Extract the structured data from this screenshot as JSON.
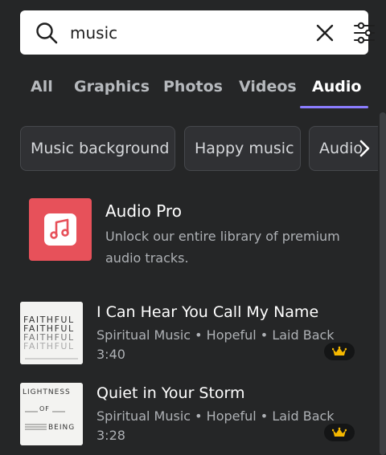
{
  "search": {
    "value": "music",
    "icon": "search-icon",
    "clear_icon": "close-icon",
    "filter_icon": "filter-sliders-icon"
  },
  "tabs": [
    {
      "label": "All"
    },
    {
      "label": "Graphics"
    },
    {
      "label": "Photos"
    },
    {
      "label": "Videos"
    },
    {
      "label": "Audio",
      "active": true
    }
  ],
  "chips": [
    {
      "label": "Music background"
    },
    {
      "label": "Happy music"
    },
    {
      "label": "Audio"
    }
  ],
  "promo": {
    "title": "Audio Pro",
    "description": "Unlock our entire library of premium audio tracks.",
    "icon": "music-note-icon"
  },
  "tracks": [
    {
      "title": "I Can Hear You Call My Name",
      "meta": "Spiritual Music • Hopeful • Laid Back",
      "duration": "3:40",
      "cover_text": "FAITHFUL",
      "badge_icon": "crown-icon"
    },
    {
      "title": "Quiet in Your Storm",
      "meta": "Spiritual Music • Hopeful • Laid Back",
      "duration": "3:28",
      "cover_lines": [
        "LIGHTNESS",
        "OF",
        "BEING"
      ],
      "badge_icon": "crown-icon"
    }
  ],
  "colors": {
    "background": "#252627",
    "accent": "#8b7dff",
    "promo_red": "#e7515a",
    "crown": "#f5b800"
  }
}
